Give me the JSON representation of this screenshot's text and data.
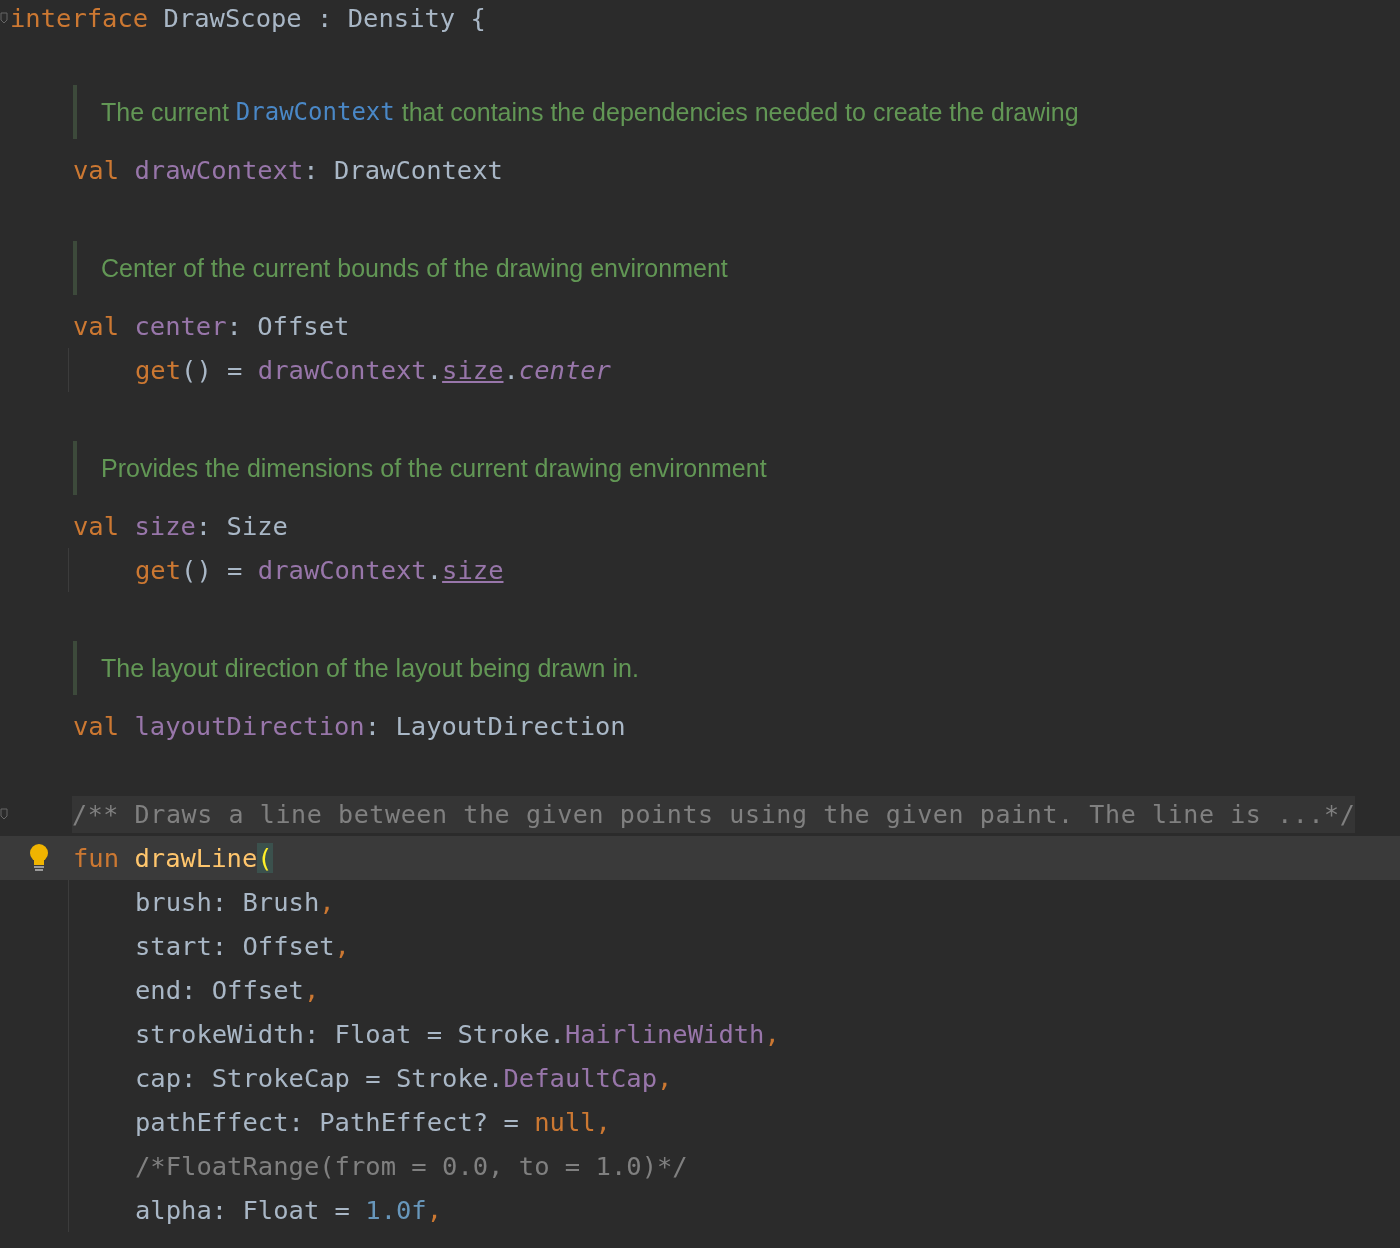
{
  "header": {
    "tokens": [
      {
        "text": "interface",
        "kind": "keyword"
      },
      {
        "text": " DrawScope : Density {",
        "kind": "plain"
      }
    ]
  },
  "members": [
    {
      "doc": [
        {
          "text": "The current "
        },
        {
          "text": "DrawContext",
          "kind": "link"
        },
        {
          "text": " that contains the dependencies needed to create the drawing"
        }
      ],
      "tokens": [
        {
          "text": "val ",
          "kind": "keyword"
        },
        {
          "text": "drawContext",
          "kind": "property"
        },
        {
          "text": ": DrawContext",
          "kind": "plain"
        }
      ]
    },
    {
      "doc": [
        {
          "text": "Center of the current bounds of the drawing environment"
        }
      ],
      "tokens": [
        {
          "text": "val ",
          "kind": "keyword"
        },
        {
          "text": "center",
          "kind": "property"
        },
        {
          "text": ": Offset",
          "kind": "plain"
        }
      ],
      "children": [
        {
          "tokens": [
            {
              "text": "get",
              "kind": "keyword"
            },
            {
              "text": "() = ",
              "kind": "plain"
            },
            {
              "text": "drawContext",
              "kind": "property"
            },
            {
              "text": ".",
              "kind": "plain"
            },
            {
              "text": "size",
              "kind": "property",
              "underlined": true
            },
            {
              "text": ".",
              "kind": "plain"
            },
            {
              "text": "center",
              "kind": "property",
              "italic": true
            }
          ]
        }
      ]
    },
    {
      "doc": [
        {
          "text": "Provides the dimensions of the current drawing environment"
        }
      ],
      "tokens": [
        {
          "text": "val ",
          "kind": "keyword"
        },
        {
          "text": "size",
          "kind": "property"
        },
        {
          "text": ": Size",
          "kind": "plain"
        }
      ],
      "children": [
        {
          "tokens": [
            {
              "text": "get",
              "kind": "keyword"
            },
            {
              "text": "() = ",
              "kind": "plain"
            },
            {
              "text": "drawContext",
              "kind": "property"
            },
            {
              "text": ".",
              "kind": "plain"
            },
            {
              "text": "size",
              "kind": "property",
              "underlined": true
            }
          ]
        }
      ]
    },
    {
      "doc": [
        {
          "text": "The layout direction of the layout being drawn in."
        }
      ],
      "tokens": [
        {
          "text": "val ",
          "kind": "keyword"
        },
        {
          "text": "layoutDirection",
          "kind": "property"
        },
        {
          "text": ": LayoutDirection",
          "kind": "plain"
        }
      ]
    },
    {
      "folded_doc": "/** Draws a line between the given points using the given paint. The line is ...*/",
      "current_line": true,
      "intention": true,
      "tokens": [
        {
          "text": "fun ",
          "kind": "keyword"
        },
        {
          "text": "drawLine",
          "kind": "function"
        },
        {
          "text": "(",
          "kind": "matched"
        }
      ],
      "children": [
        {
          "tokens": [
            {
              "text": "brush: Brush",
              "kind": "plain"
            },
            {
              "text": ",",
              "kind": "keyword"
            }
          ]
        },
        {
          "tokens": [
            {
              "text": "start: Offset",
              "kind": "plain"
            },
            {
              "text": ",",
              "kind": "keyword"
            }
          ]
        },
        {
          "tokens": [
            {
              "text": "end: Offset",
              "kind": "plain"
            },
            {
              "text": ",",
              "kind": "keyword"
            }
          ]
        },
        {
          "tokens": [
            {
              "text": "strokeWidth: Float = Stroke.",
              "kind": "plain"
            },
            {
              "text": "HairlineWidth",
              "kind": "property"
            },
            {
              "text": ",",
              "kind": "keyword"
            }
          ]
        },
        {
          "tokens": [
            {
              "text": "cap: StrokeCap = Stroke.",
              "kind": "plain"
            },
            {
              "text": "DefaultCap",
              "kind": "property"
            },
            {
              "text": ",",
              "kind": "keyword"
            }
          ]
        },
        {
          "tokens": [
            {
              "text": "pathEffect: PathEffect? = ",
              "kind": "plain"
            },
            {
              "text": "null",
              "kind": "keyword"
            },
            {
              "text": ",",
              "kind": "keyword"
            }
          ]
        },
        {
          "tokens": [
            {
              "text": "/*FloatRange(from = 0.0, to = 1.0)*/",
              "kind": "comment"
            }
          ]
        },
        {
          "tokens": [
            {
              "text": "alpha: Float = ",
              "kind": "plain"
            },
            {
              "text": "1.0f",
              "kind": "number"
            },
            {
              "text": ",",
              "kind": "keyword"
            }
          ]
        }
      ]
    }
  ]
}
